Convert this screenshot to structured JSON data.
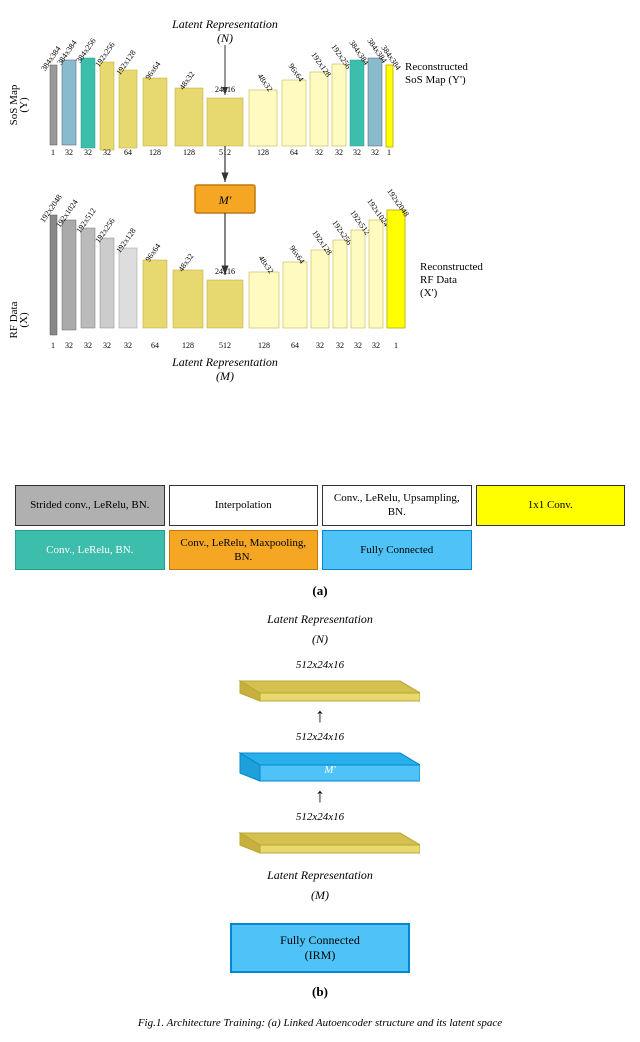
{
  "diagram": {
    "title_latent_top": "Latent Representation",
    "title_latent_n": "(N)",
    "title_latent_bottom": "Latent Representation",
    "title_latent_m": "(M)",
    "sos_map_label": "SoS Map (Y)",
    "rf_data_label": "RF Data (X)",
    "reconstructed_sos_label": "Reconstructed SoS Map (Y')",
    "reconstructed_rf_label": "Reconstructed RF Data (X')",
    "m_prime_label": "M'",
    "fig_a_label": "(a)",
    "fig_b_label": "(b)"
  },
  "legend": {
    "item1": "Strided conv., LeRelu, BN.",
    "item2": "Interpolation",
    "item3": "Conv., LeRelu, Upsampling, BN.",
    "item4": "1x1 Conv.",
    "item5": "Conv., LeRelu, BN.",
    "item6": "Conv., LeRelu, Maxpooling, BN.",
    "item7": "Fully Connected"
  },
  "part_b": {
    "title": "Latent Representation",
    "subtitle": "(N)",
    "layer1_label": "512x24x16",
    "layer2_label": "512x24x16",
    "layer3_label": "512x24x16",
    "m_prime": "M'",
    "bottom_title": "Latent Representation",
    "bottom_subtitle": "(M)",
    "fc_line1": "Fully Connected",
    "fc_line2": "(IRM)"
  },
  "encoder_top_channels": [
    "1",
    "32",
    "32",
    "32",
    "64",
    "128",
    "512",
    "128",
    "64",
    "32",
    "32",
    "32",
    "1"
  ],
  "encoder_top_sizes": [
    "384x384",
    "384x384",
    "384x256",
    "192x256",
    "192x128",
    "96x64",
    "48x32",
    "24x16",
    "48x32",
    "96x64",
    "192x128",
    "192x256",
    "384x384",
    "384x384"
  ],
  "encoder_bot_channels": [
    "1",
    "32",
    "32",
    "32",
    "64",
    "128",
    "512",
    "128",
    "64",
    "32",
    "32",
    "32",
    "1"
  ],
  "encoder_bot_sizes": [
    "192x2048",
    "192x1024",
    "192x512",
    "192x256",
    "192x128",
    "96x64",
    "48x32",
    "24x16",
    "48x32",
    "96x64",
    "192x128",
    "192x256",
    "192x512",
    "192x1024",
    "192x2048"
  ],
  "caption": "Fig.1. Architecture Training: (a) Linked Autoencoder structure and its latent space"
}
